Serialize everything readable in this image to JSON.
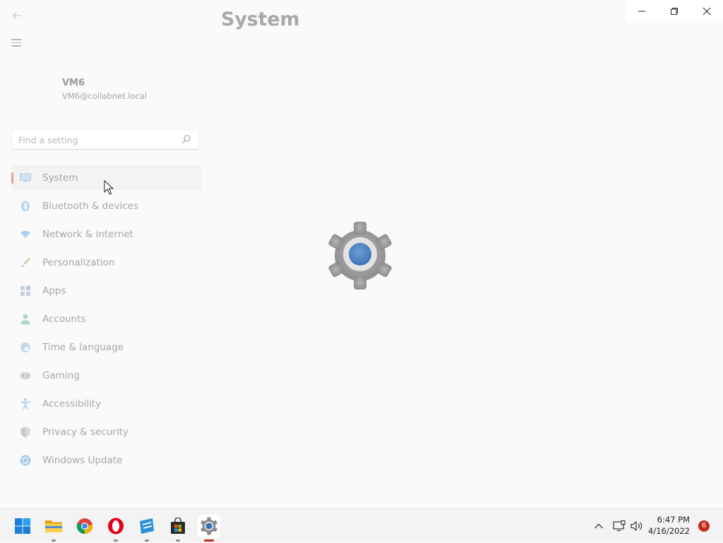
{
  "window": {
    "title": "System",
    "controls": {
      "minimize": "—",
      "restore": "❐",
      "close": "✕"
    }
  },
  "user": {
    "name": "VM6",
    "email": "VM6@collabnet.local"
  },
  "search": {
    "placeholder": "Find a setting"
  },
  "sidebar": {
    "items": [
      {
        "label": "System",
        "icon": "system-display-icon",
        "active": true
      },
      {
        "label": "Bluetooth & devices",
        "icon": "bluetooth-icon"
      },
      {
        "label": "Network & internet",
        "icon": "wifi-icon"
      },
      {
        "label": "Personalization",
        "icon": "brush-icon"
      },
      {
        "label": "Apps",
        "icon": "apps-icon"
      },
      {
        "label": "Accounts",
        "icon": "person-icon"
      },
      {
        "label": "Time & language",
        "icon": "globe-clock-icon"
      },
      {
        "label": "Gaming",
        "icon": "gamepad-icon"
      },
      {
        "label": "Accessibility",
        "icon": "accessibility-icon"
      },
      {
        "label": "Privacy & security",
        "icon": "shield-icon"
      },
      {
        "label": "Windows Update",
        "icon": "sync-icon"
      }
    ]
  },
  "taskbar": {
    "apps": [
      "start-icon",
      "file-explorer-icon",
      "chrome-icon",
      "opera-icon",
      "remote-desktop-icon",
      "microsoft-store-icon",
      "settings-icon"
    ],
    "time": "6:47 PM",
    "date": "4/16/2022",
    "notification_count": "6"
  },
  "colors": {
    "accent": "#c42b1c",
    "active_indicator": "#e8a08c",
    "gear_blue": "#4f86c6"
  }
}
